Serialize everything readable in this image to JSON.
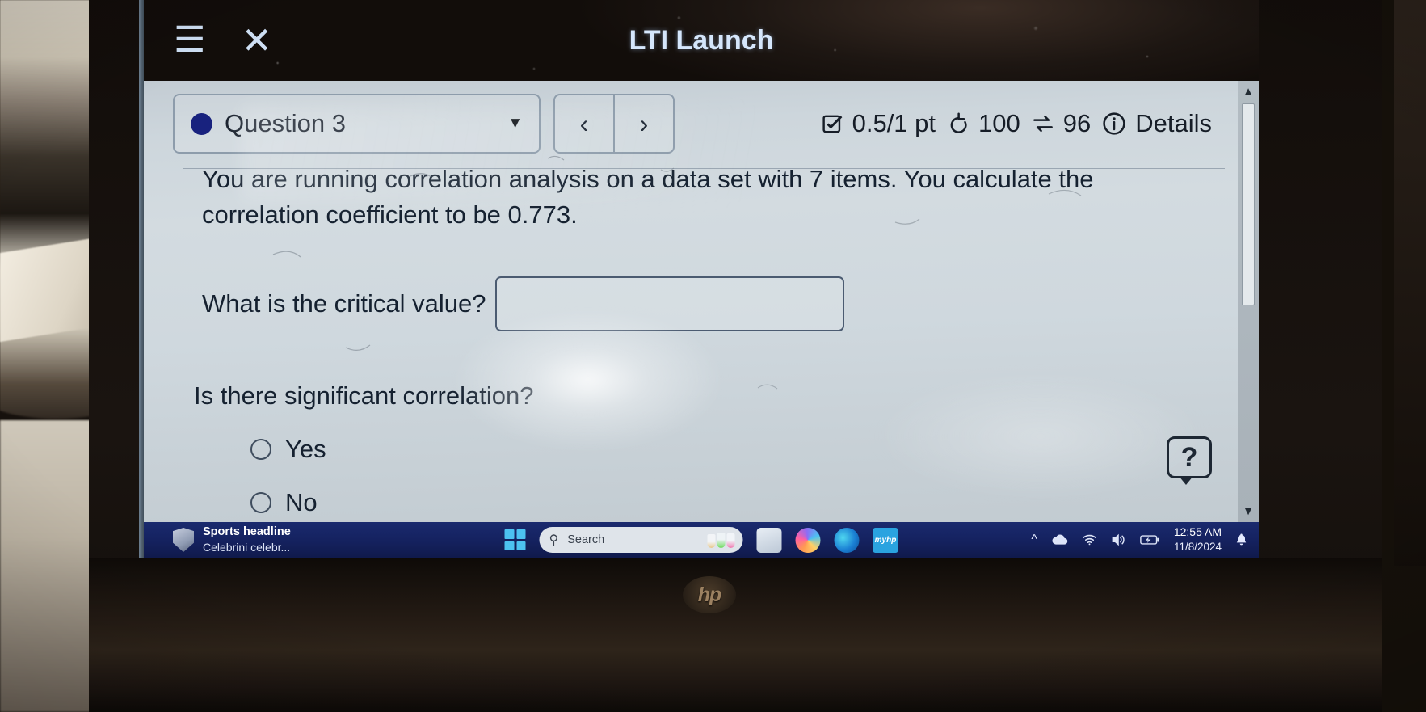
{
  "window": {
    "title": "LTI Launch",
    "menu_icon": "hamburger-menu-icon",
    "close_icon": "close-icon"
  },
  "toolbar": {
    "question_label": "Question 3",
    "dropdown_caret": "▼",
    "prev_label": "‹",
    "next_label": "›",
    "score": "0.5/1 pt",
    "attempts": "100",
    "swaps": "96",
    "details_label": "Details",
    "accent_dot_color": "#18227e"
  },
  "question": {
    "prompt_line1": "You are running correlation analysis on a data set with 7 items. You calculate the",
    "prompt_line2": "correlation coefficient to be 0.773.",
    "critical_value_label": "What is the critical value?",
    "critical_value_answer": "",
    "critical_value_placeholder": "",
    "significance_label": "Is there significant correlation?",
    "options": [
      {
        "label": "Yes",
        "selected": false
      },
      {
        "label": "No",
        "selected": false
      }
    ]
  },
  "help": {
    "label": "?"
  },
  "scrollbar": {
    "up": "▲",
    "down": "▼"
  },
  "taskbar": {
    "news": {
      "headline": "Sports headline",
      "subtext": "Celebrini celebr..."
    },
    "search": {
      "placeholder": "Search",
      "icon": "search-icon"
    },
    "apps": [
      {
        "name": "start-button"
      },
      {
        "name": "file-explorer"
      },
      {
        "name": "copilot"
      },
      {
        "name": "microsoft-edge"
      },
      {
        "name": "my-hp",
        "label": "myhp"
      }
    ],
    "tray": {
      "overflow": "^",
      "onedrive": "cloud-icon",
      "wifi": "wifi-icon",
      "volume": "volume-icon",
      "battery": "battery-charging-icon",
      "time": "12:55 AM",
      "date": "11/8/2024",
      "notification": "bell-icon"
    }
  },
  "device": {
    "brand": "hp"
  }
}
